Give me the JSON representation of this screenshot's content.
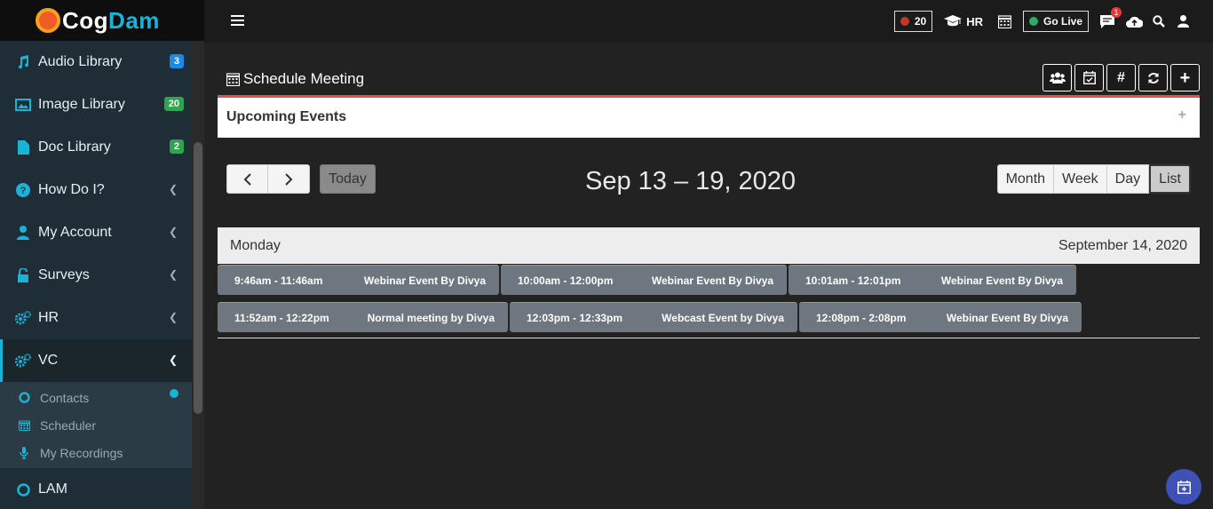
{
  "app": {
    "logo_text_1": "Cog",
    "logo_text_2": "Dam"
  },
  "sidebar": {
    "items": [
      {
        "label": "Audio Library",
        "badge": "3",
        "icon": "music-icon"
      },
      {
        "label": "Image Library",
        "badge": "20",
        "icon": "image-icon"
      },
      {
        "label": "Doc Library",
        "badge": "2",
        "icon": "file-icon"
      },
      {
        "label": "How Do I?",
        "icon": "question-icon"
      },
      {
        "label": "My Account",
        "icon": "user-icon"
      },
      {
        "label": "Surveys",
        "icon": "unlock-icon"
      },
      {
        "label": "HR",
        "icon": "cogs-icon"
      },
      {
        "label": "VC",
        "icon": "cogs-icon"
      },
      {
        "label": "LAM",
        "icon": "circle-icon"
      }
    ],
    "vc_submenu": [
      {
        "label": "Contacts",
        "icon": "circle-icon"
      },
      {
        "label": "Scheduler",
        "icon": "calendar-icon"
      },
      {
        "label": "My Recordings",
        "icon": "microphone-icon"
      }
    ]
  },
  "topbar": {
    "record_count": "20",
    "hr_label": "HR",
    "go_live_label": "Go Live",
    "chat_badge": "1",
    "colors": {
      "record_dot": "#c0392b",
      "live_dot": "#27ae60"
    }
  },
  "main": {
    "page_title": "Schedule Meeting",
    "panel_title": "Upcoming Events",
    "panel_toggle": "+",
    "today_label": "Today",
    "range_title": "Sep 13 – 19, 2020",
    "views": [
      "Month",
      "Week",
      "Day",
      "List"
    ],
    "active_view": "List",
    "day_name": "Monday",
    "day_date": "September 14, 2020",
    "events": [
      [
        {
          "time": "9:46am - 11:46am",
          "title": "Webinar Event By Divya"
        },
        {
          "time": "10:00am - 12:00pm",
          "title": "Webinar Event By Divya"
        },
        {
          "time": "10:01am - 12:01pm",
          "title": "Webinar Event By Divya"
        }
      ],
      [
        {
          "time": "11:52am - 12:22pm",
          "title": "Normal meeting by Divya"
        },
        {
          "time": "12:03pm - 12:33pm",
          "title": "Webcast Event by Divya"
        },
        {
          "time": "12:08pm - 2:08pm",
          "title": "Webinar Event By Divya"
        }
      ]
    ]
  }
}
